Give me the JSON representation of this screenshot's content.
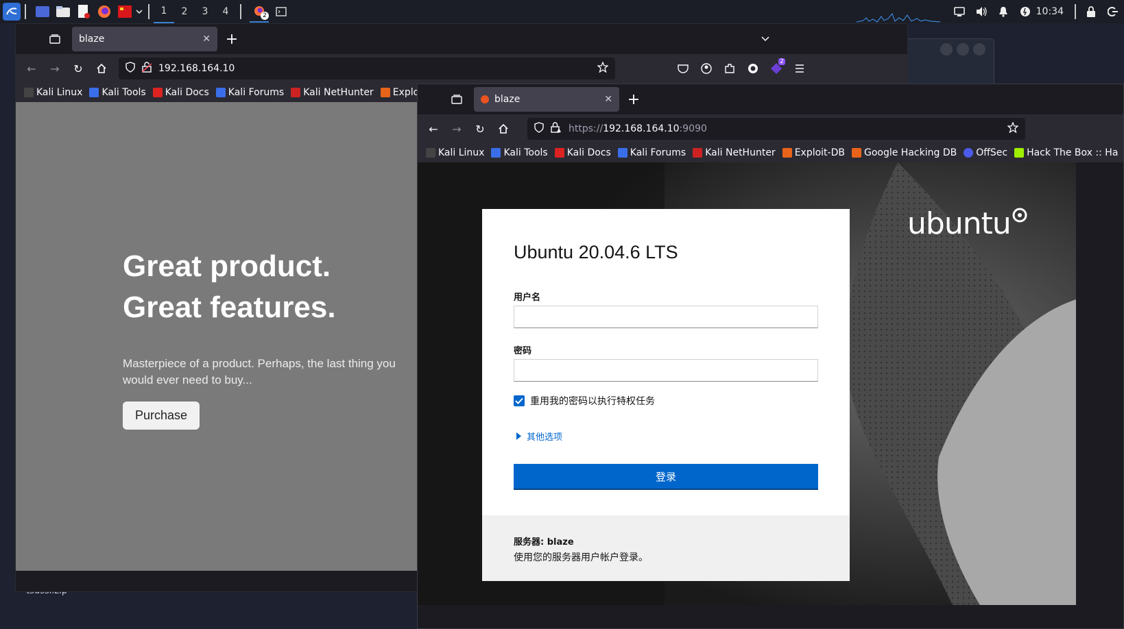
{
  "taskbar": {
    "workspaces": [
      "1",
      "2",
      "3",
      "4"
    ],
    "active_workspace": 0,
    "firefox_badge": "2",
    "clock": "10:34",
    "accent": "#3b82d6"
  },
  "desktop": {
    "file_label": "tsussi.zip"
  },
  "window_left": {
    "tab_title": "blaze",
    "new_tab": "+",
    "url": "192.168.164.10",
    "ext_badge": "2",
    "bookmarks": [
      "Kali Linux",
      "Kali Tools",
      "Kali Docs",
      "Kali Forums",
      "Kali NetHunter",
      "Exploit-DB"
    ],
    "page": {
      "title_line1": "Great product.",
      "title_line2": "Great features.",
      "description": "Masterpiece of a product. Perhaps, the last thing you would ever need to buy...",
      "purchase_label": "Purchase"
    }
  },
  "window_right": {
    "tab_title": "blaze",
    "new_tab": "+",
    "url_prefix": "https://",
    "url_host": "192.168.164.10",
    "url_port": ":9090",
    "bookmarks": [
      "Kali Linux",
      "Kali Tools",
      "Kali Docs",
      "Kali Forums",
      "Kali NetHunter",
      "Exploit-DB",
      "Google Hacking DB",
      "OffSec",
      "Hack The Box :: Ha"
    ],
    "page": {
      "brand": "ubuntu",
      "os_title": "Ubuntu 20.04.6 LTS",
      "username_label": "用户名",
      "username_value": "",
      "password_label": "密码",
      "password_value": "",
      "reuse_password_label": "重用我的密码以执行特权任务",
      "reuse_password_checked": true,
      "other_options_label": "其他选项",
      "login_label": "登录",
      "server_label": "服务器: blaze",
      "server_hint": "使用您的服务器用户帐户登录。",
      "accent": "#0066cc"
    }
  }
}
